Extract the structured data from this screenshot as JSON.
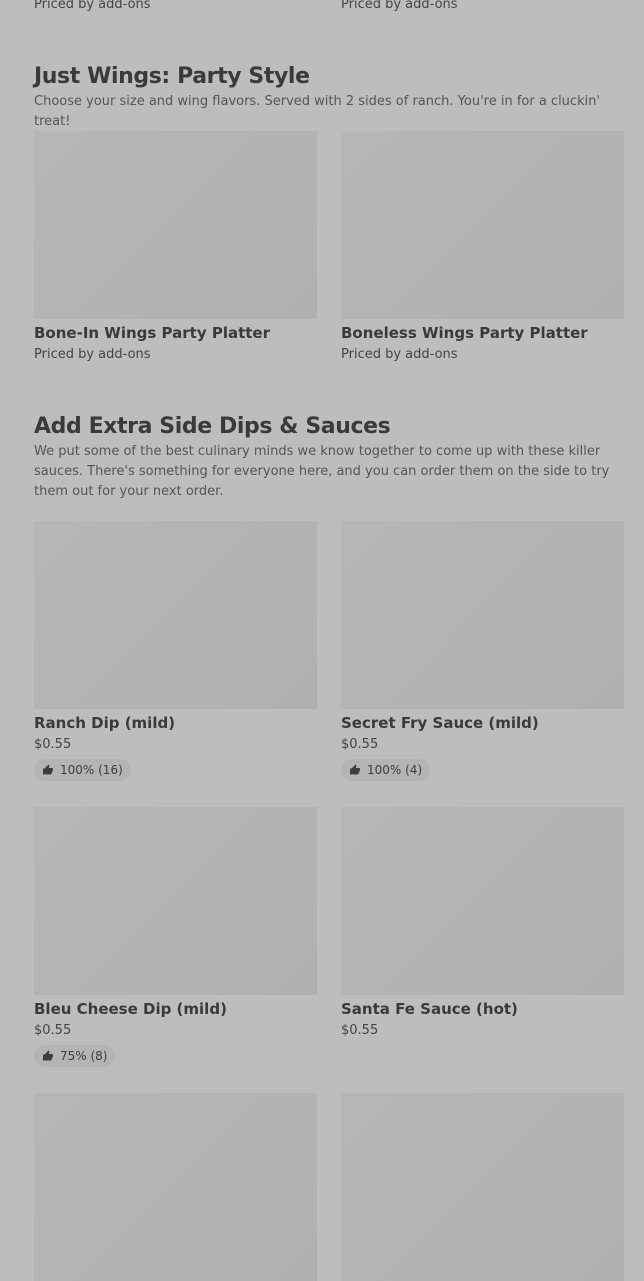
{
  "top_row": [
    "Priced by add-ons",
    "Priced by add-ons"
  ],
  "sections": [
    {
      "title": "Just Wings: Party Style",
      "description": "Choose your size and wing flavors. Served with 2 sides of ranch. You're in for a cluckin' treat!",
      "items": [
        {
          "name": "Bone-In Wings Party Platter",
          "price": "Priced by add-ons"
        },
        {
          "name": "Boneless Wings Party Platter",
          "price": "Priced by add-ons"
        }
      ]
    },
    {
      "title": "Add Extra Side Dips & Sauces",
      "description": "We put some of the best culinary minds we know together to come up with these killer sauces. There's something for everyone here, and you can order them on the side to try them out for your next order.",
      "items": [
        {
          "name": "Ranch Dip (mild)",
          "price": "$0.55",
          "rating": "100% (16)"
        },
        {
          "name": "Secret Fry Sauce (mild)",
          "price": "$0.55",
          "rating": "100% (4)"
        },
        {
          "name": "Bleu Cheese Dip (mild)",
          "price": "$0.55",
          "rating": "75% (8)"
        },
        {
          "name": "Santa Fe Sauce (hot)",
          "price": "$0.55"
        }
      ]
    }
  ],
  "icons": {
    "rating": "thumbs-up-icon"
  }
}
